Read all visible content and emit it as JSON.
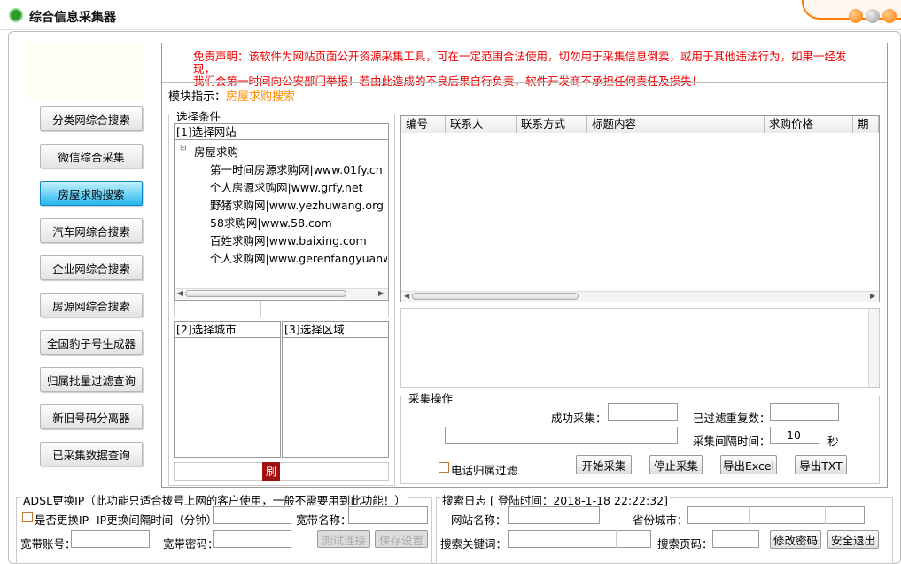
{
  "window": {
    "title": "综合信息采集器"
  },
  "nav": {
    "items": [
      {
        "label": "分类网综合搜索"
      },
      {
        "label": "微信综合采集"
      },
      {
        "label": "房屋求购搜索"
      },
      {
        "label": "汽车网综合搜索"
      },
      {
        "label": "企业网综合搜索"
      },
      {
        "label": "房源网综合搜索"
      },
      {
        "label": "全国豹子号生成器"
      },
      {
        "label": "归属批量过滤查询"
      },
      {
        "label": "新旧号码分离器"
      },
      {
        "label": "已采集数据查询"
      }
    ],
    "active_index": 2
  },
  "disclaimer": {
    "line1": "免责声明：该软件为网站页面公开资源采集工具，可在一定范围合法使用，切勿用于采集信息倒卖，或用于其他违法行为，如果一经发现，",
    "line2": "我们会第一时间向公安部门举报！若由此造成的不良后果自行负责，软件开发商不承担任何责任及损失！"
  },
  "module": {
    "label": "模块指示：",
    "value": "房屋求购搜索"
  },
  "conditions": {
    "title": "选择条件",
    "site_header": "[1]选择网站",
    "tree_root": "房屋求购",
    "tree_items": [
      "第一时间房源求购网|www.01fy.cn",
      "个人房源求购网|www.grfy.net",
      "野猪求购网|www.yezhuwang.org",
      "58求购网|www.58.com",
      "百姓求购网|www.baixing.com",
      "个人求购网|www.gerenfangyuanwar"
    ],
    "city_header": "[2]选择城市",
    "area_header": "[3]选择区域",
    "refresh_label": "刷"
  },
  "table": {
    "columns": [
      "编号",
      "联系人",
      "联系方式",
      "标题内容",
      "求购价格",
      "期望"
    ]
  },
  "collect": {
    "title": "采集操作",
    "success_label": "成功采集：",
    "dup_label": "已过滤重复数：",
    "interval_label": "采集间隔时间：",
    "interval_value": "10",
    "interval_unit": "秒",
    "phone_filter_label": "电话归属过滤",
    "start_label": "开始采集",
    "stop_label": "停止采集",
    "excel_label": "导出Excel",
    "txt_label": "导出TXT"
  },
  "adsl": {
    "title": "ADSL更换IP（此功能只适合拨号上网的客户使用，一般不需要用到此功能！）",
    "change_ip_label": "是否更换IP",
    "interval_label": "IP更换间隔时间（分钟）",
    "bb_name_label": "宽带名称：",
    "bb_account_label": "宽带账号：",
    "bb_password_label": "宽带密码：",
    "test_label": "测试连接",
    "save_label": "保存设置"
  },
  "log": {
    "title": "搜索日志 [ 登陆时间：2018-1-18 22:22:32]",
    "site_name_label": "网站名称：",
    "province_label": "省份城市：",
    "keyword_label": "搜索关键词：",
    "page_label": "搜索页码：",
    "change_pw_label": "修改密码",
    "exit_label": "安全退出"
  },
  "colors": {
    "accent": "#ff7a00",
    "active_nav": "#25b8ee",
    "disclaimer": "#e00000",
    "module_value": "#ff8c00"
  }
}
